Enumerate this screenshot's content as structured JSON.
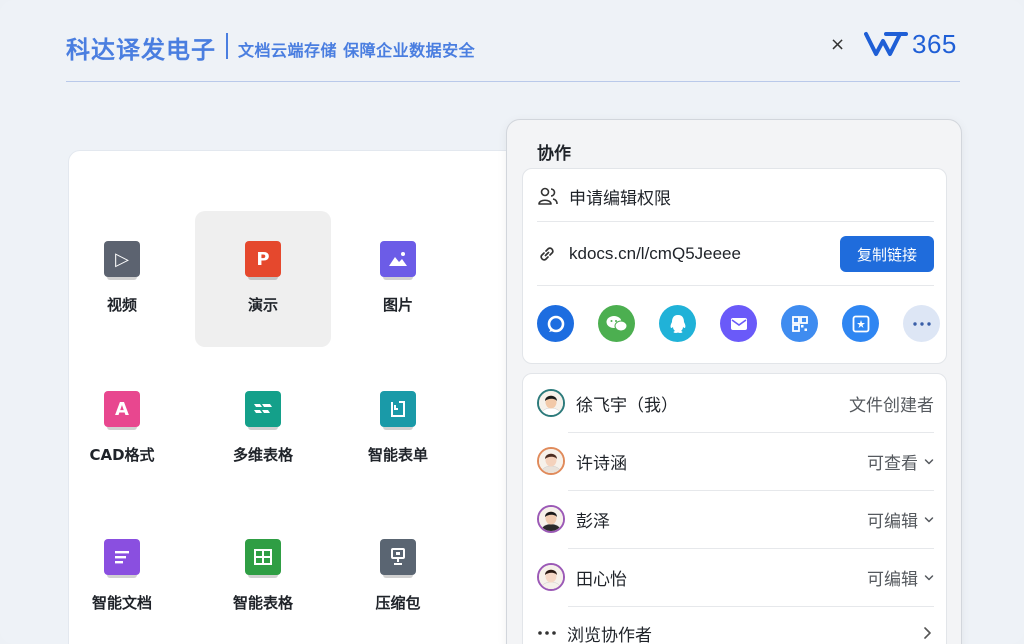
{
  "header": {
    "brand": "科达译发电子",
    "slogan": "文档云端存储 保障企业数据安全",
    "close_symbol": "×",
    "logo_text": "365",
    "logo_icon": "wps-w-logo-icon"
  },
  "file_types": [
    {
      "label": "视频",
      "icon": "video-icon",
      "color": "#5c6370",
      "glyph": "▷",
      "selected": false
    },
    {
      "label": "演示",
      "icon": "presentation-icon",
      "color": "#e5482d",
      "glyph": "P",
      "selected": true
    },
    {
      "label": "图片",
      "icon": "image-icon",
      "color": "#6c5ce7",
      "glyph": "",
      "selected": false
    },
    {
      "label": "CAD格式",
      "icon": "cad-icon",
      "color": "#e8478f",
      "glyph": "A",
      "selected": false
    },
    {
      "label": "多维表格",
      "icon": "multi-table-icon",
      "color": "#14a08a",
      "glyph": "",
      "selected": false
    },
    {
      "label": "智能表单",
      "icon": "smart-form-icon",
      "color": "#1a9aa8",
      "glyph": "",
      "selected": false
    },
    {
      "label": "智能文档",
      "icon": "smart-doc-icon",
      "color": "#8a4fe0",
      "glyph": "",
      "selected": false
    },
    {
      "label": "智能表格",
      "icon": "smart-sheet-icon",
      "color": "#2f9e44",
      "glyph": "",
      "selected": false
    },
    {
      "label": "压缩包",
      "icon": "archive-icon",
      "color": "#5a6572",
      "glyph": "",
      "selected": false
    }
  ],
  "collab": {
    "title": "协作",
    "request_label": "申请编辑权限",
    "link_text": "kdocs.cn/l/cmQ5Jeeee",
    "copy_label": "复制链接",
    "share_icons": [
      {
        "name": "kdocs-share-icon",
        "color": "#1d6de0"
      },
      {
        "name": "wechat-share-icon",
        "color": "#4caf50"
      },
      {
        "name": "qq-share-icon",
        "color": "#20b2d8"
      },
      {
        "name": "email-share-icon",
        "color": "#6a5af9"
      },
      {
        "name": "qrcode-share-icon",
        "color": "#3f8cf0"
      },
      {
        "name": "dingtalk-share-icon",
        "color": "#2f86f2"
      },
      {
        "name": "more-share-icon",
        "color": "#dde6f5"
      }
    ],
    "members": [
      {
        "name": "徐飞宇（我）",
        "role": "文件创建者",
        "editable": false,
        "ring": "#2c7a7b",
        "skin": "#f2c9a8",
        "hair": "#1a1a1a",
        "shirt": "#ffffff"
      },
      {
        "name": "许诗涵",
        "role": "可查看",
        "editable": true,
        "ring": "#e08a5a",
        "skin": "#f4d2bc",
        "hair": "#4a2d22",
        "shirt": "#e9e2da"
      },
      {
        "name": "彭泽",
        "role": "可编辑",
        "editable": true,
        "ring": "#9b59b6",
        "skin": "#f0cbb0",
        "hair": "#1a1a1a",
        "shirt": "#2a2a2a"
      },
      {
        "name": "田心怡",
        "role": "可编辑",
        "editable": true,
        "ring": "#9b59b6",
        "skin": "#f4d7c6",
        "hair": "#2a1a14",
        "shirt": "#f5f0ea"
      }
    ],
    "browse_label": "浏览协作者"
  }
}
